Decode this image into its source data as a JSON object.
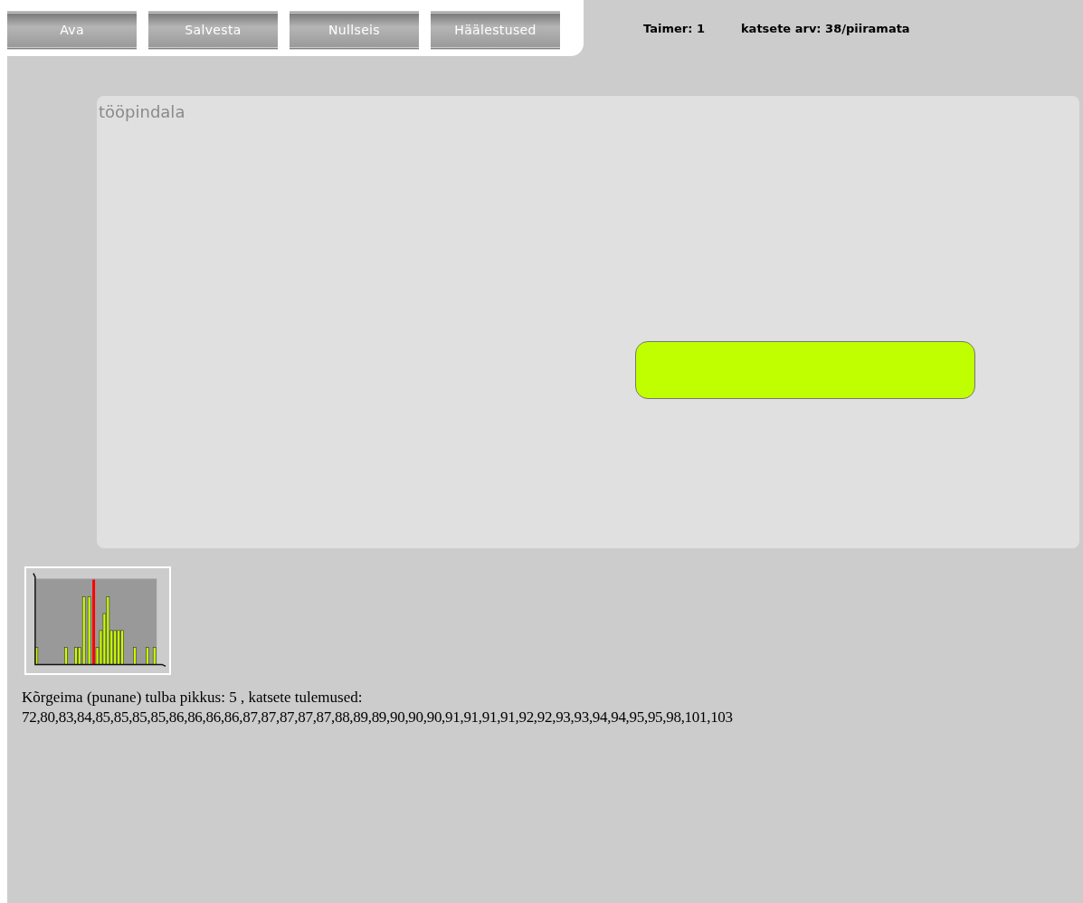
{
  "toolbar": {
    "buttons": [
      "Ava",
      "Salvesta",
      "Nullseis",
      "Häälestused"
    ]
  },
  "status": {
    "timer": "Taimer: 1",
    "attempts": "katsete arv: 38/piiramata"
  },
  "workspace": {
    "label": "tööpindala"
  },
  "results": {
    "summary": "Kõrgeima (punane) tulba pikkus: 5 , katsete tulemused:",
    "values": "72,80,83,84,85,85,85,85,86,86,86,86,87,87,87,87,87,88,89,89,90,90,90,91,91,91,91,92,92,93,93,94,94,95,95,98,101,103"
  }
}
